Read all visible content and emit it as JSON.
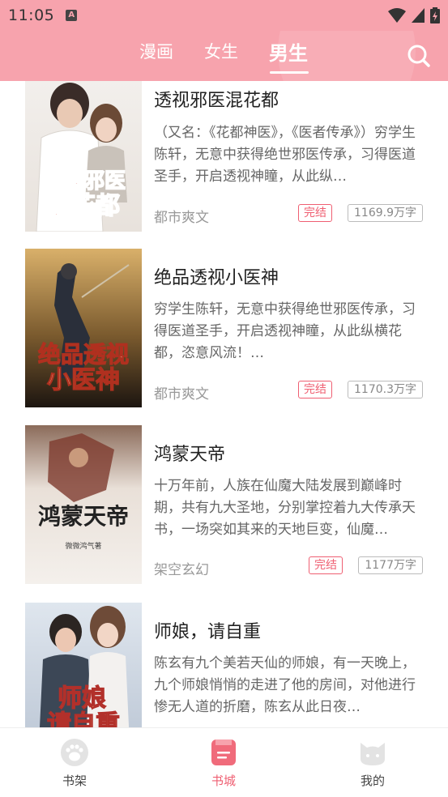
{
  "status_bar": {
    "time": "11:05",
    "notification_glyph": "A"
  },
  "header": {
    "tabs": [
      {
        "label": "漫画",
        "active": false
      },
      {
        "label": "女生",
        "active": false
      },
      {
        "label": "男生",
        "active": true
      }
    ],
    "search_icon": "search-icon"
  },
  "books": [
    {
      "title": "透视邪医混花都",
      "description": "（又名：《花都神医》，《医者传承》）穷学生陈轩，无意中获得绝世邪医传承，习得医道圣手，开启透视神瞳，从此纵…",
      "category": "都市爽文",
      "status": "完结",
      "word_count": "1169.9万字",
      "cover_text": "透视邪医混花都"
    },
    {
      "title": "绝品透视小医神",
      "description": "穷学生陈轩，无意中获得绝世邪医传承，习得医道圣手，开启透视神瞳，从此纵横花都，恣意风流！…",
      "category": "都市爽文",
      "status": "完结",
      "word_count": "1170.3万字",
      "cover_text": "绝品透视小医神"
    },
    {
      "title": "鸿蒙天帝",
      "description": "十万年前，人族在仙魔大陆发展到巅峰时期，共有九大圣地，分别掌控着九大传承天书，一场突如其来的天地巨变，仙魔…",
      "category": "架空玄幻",
      "status": "完结",
      "word_count": "1177万字",
      "cover_text": "鸿蒙天帝",
      "cover_author": "微微鸿气著"
    },
    {
      "title": "师娘，请自重",
      "description": "陈玄有九个美若天仙的师娘，有一天晚上，九个师娘悄悄的走进了他的房间，对他进行惨无人道的折磨，陈玄从此日夜…",
      "category": "",
      "status": "",
      "word_count": "",
      "cover_text": "师娘请自重"
    }
  ],
  "bottom_nav": {
    "items": [
      {
        "label": "书架",
        "icon": "paw-icon",
        "active": false
      },
      {
        "label": "书城",
        "icon": "book-store-icon",
        "active": true
      },
      {
        "label": "我的",
        "icon": "cat-face-icon",
        "active": false
      }
    ]
  },
  "colors": {
    "header_pink": "#f7a3ad",
    "accent_red": "#ef5f72",
    "inactive_icon": "#e0e0e0"
  }
}
